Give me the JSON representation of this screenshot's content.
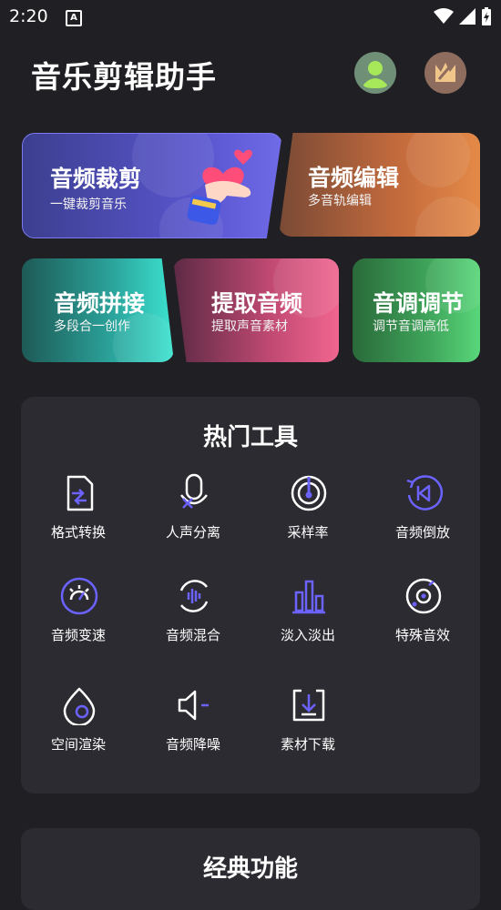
{
  "status_bar": {
    "time": "2:20",
    "notification_glyph": "A"
  },
  "header": {
    "title": "音乐剪辑助手"
  },
  "feature_cards": {
    "trim": {
      "title": "音频裁剪",
      "subtitle": "一键裁剪音乐"
    },
    "edit": {
      "title": "音频编辑",
      "subtitle": "多音轨编辑"
    },
    "concat": {
      "title": "音频拼接",
      "subtitle": "多段合一创作"
    },
    "extract": {
      "title": "提取音频",
      "subtitle": "提取声音素材"
    },
    "pitch": {
      "title": "音调调节",
      "subtitle": "调节音调高低"
    }
  },
  "hot_tools": {
    "title": "热门工具",
    "items": [
      {
        "label": "格式转换",
        "icon": "file-convert-icon"
      },
      {
        "label": "人声分离",
        "icon": "vocal-separate-icon"
      },
      {
        "label": "采样率",
        "icon": "sample-rate-icon"
      },
      {
        "label": "音频倒放",
        "icon": "reverse-icon"
      },
      {
        "label": "音频变速",
        "icon": "speed-icon"
      },
      {
        "label": "音频混合",
        "icon": "mix-icon"
      },
      {
        "label": "淡入淡出",
        "icon": "fade-icon"
      },
      {
        "label": "特殊音效",
        "icon": "effects-icon"
      },
      {
        "label": "空间渲染",
        "icon": "spatial-icon"
      },
      {
        "label": "音频降噪",
        "icon": "denoise-icon"
      },
      {
        "label": "素材下载",
        "icon": "download-icon"
      }
    ]
  },
  "classic": {
    "title": "经典功能"
  },
  "colors": {
    "accent": "#6c63ff",
    "background": "#202024",
    "panel": "#2b2b31"
  }
}
